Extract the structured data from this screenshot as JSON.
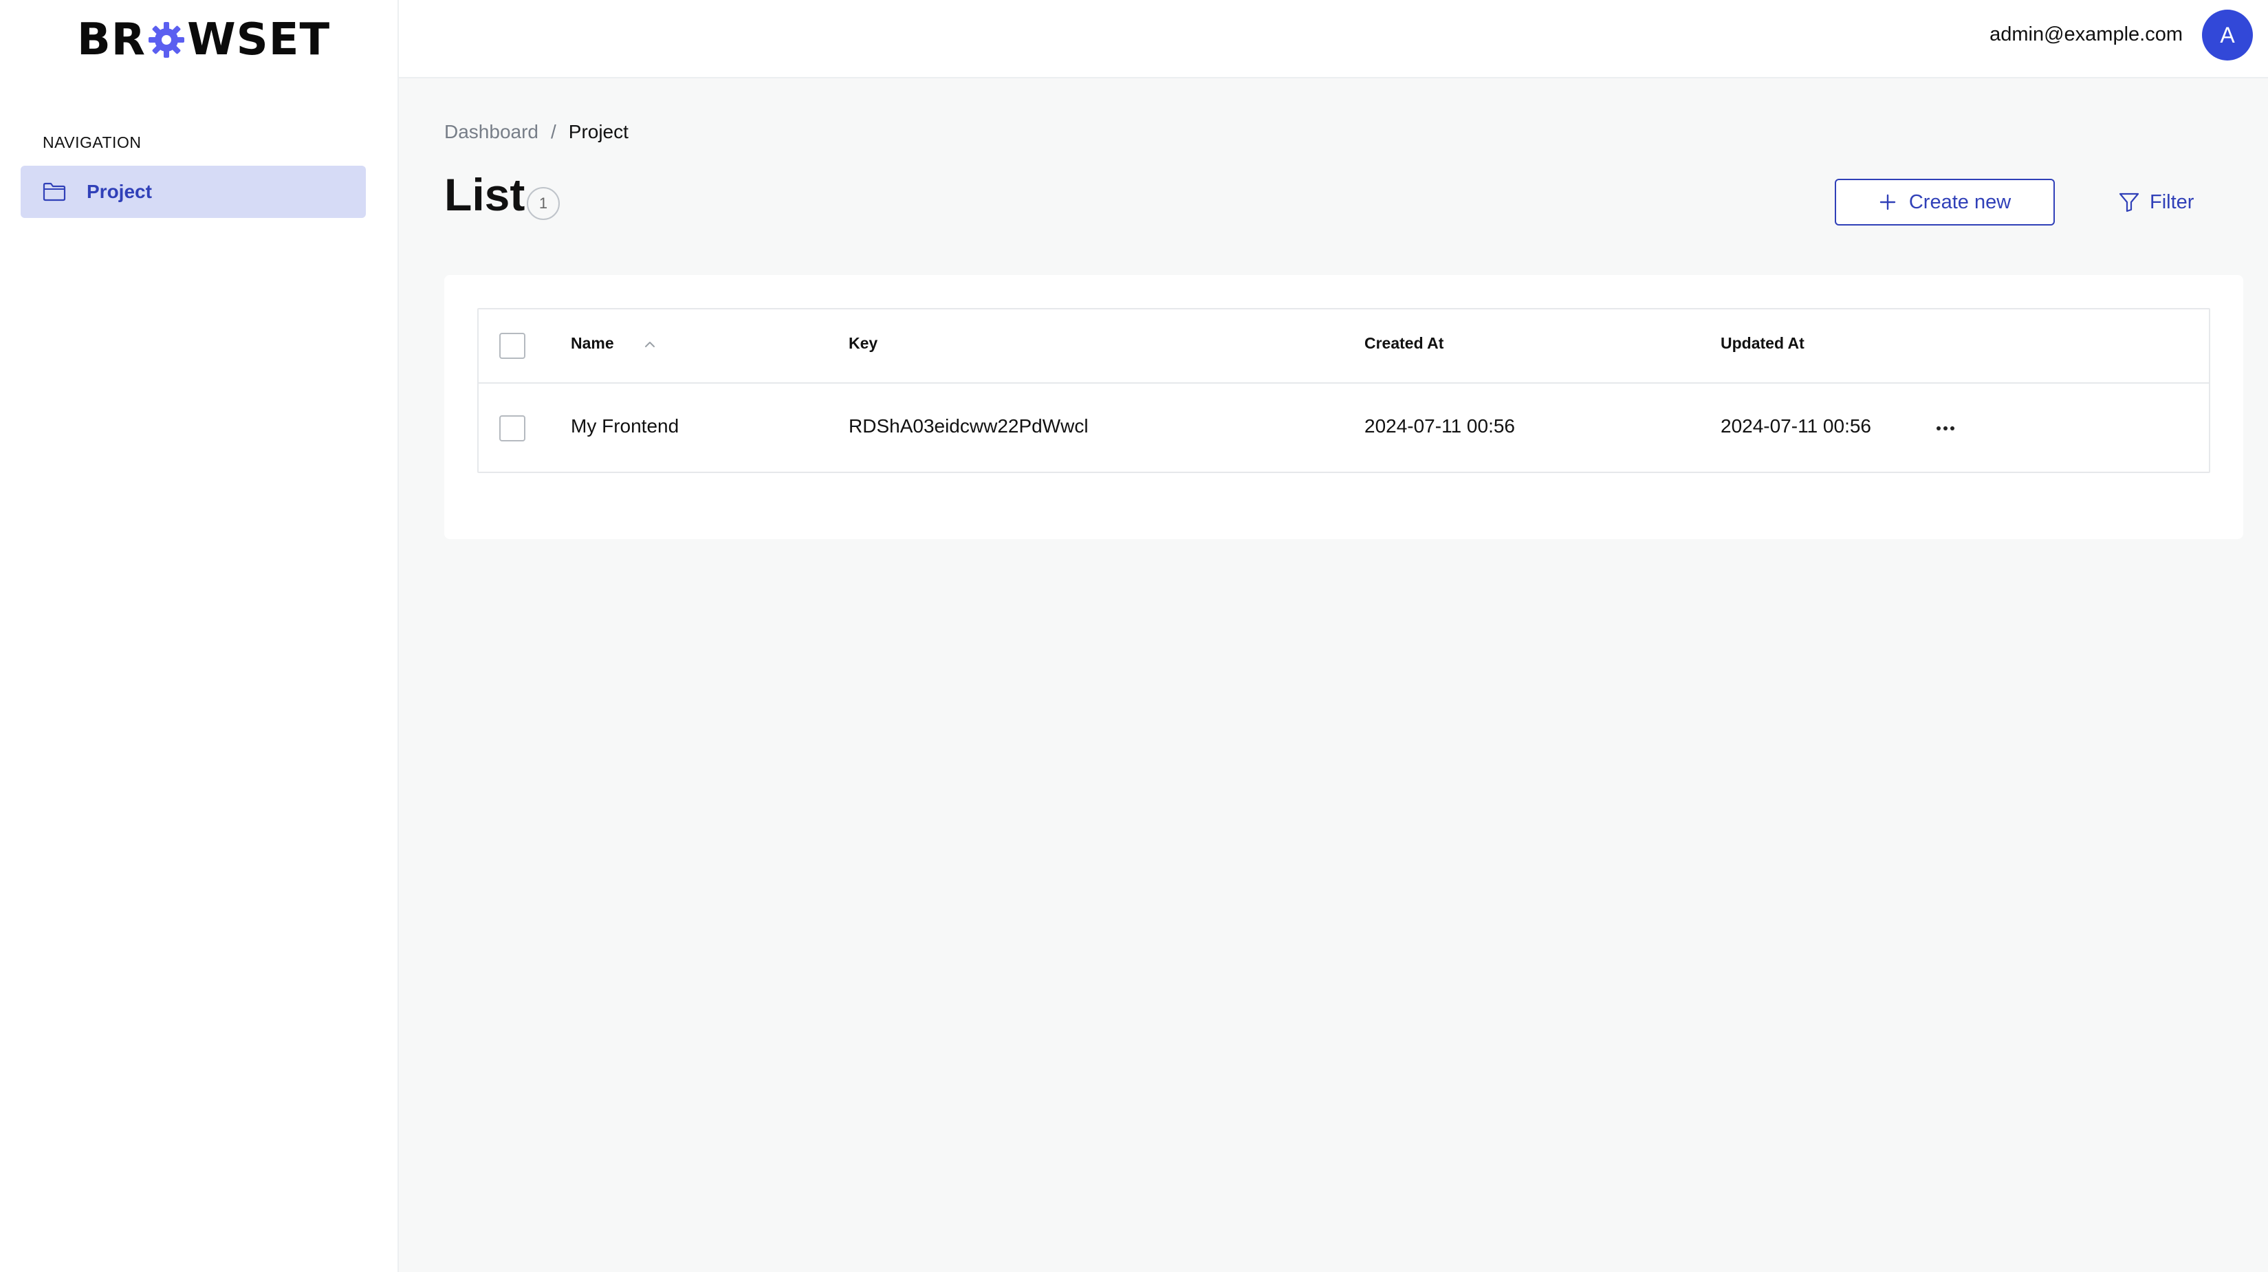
{
  "app": {
    "logo_text_left": "BR",
    "logo_text_right": "WSET",
    "brand_color": "#3040b8",
    "logo_gear_color": "#5b5ff0"
  },
  "sidebar": {
    "heading": "NAVIGATION",
    "items": [
      {
        "label": "Project",
        "icon": "folder-icon",
        "active": true
      }
    ]
  },
  "topbar": {
    "user_email": "admin@example.com",
    "avatar_initial": "A",
    "avatar_color": "#3248d8"
  },
  "breadcrumb": {
    "items": [
      "Dashboard",
      "Project"
    ],
    "separator": "/"
  },
  "page": {
    "title": "List",
    "count": "1"
  },
  "actions": {
    "create_label": "Create new",
    "filter_label": "Filter"
  },
  "table": {
    "columns": [
      "Name",
      "Key",
      "Created At",
      "Updated At"
    ],
    "sorted_by": "Name",
    "rows": [
      {
        "name": "My Frontend",
        "key": "RDShA03eidcww22PdWwcl",
        "created_at": "2024-07-11 00:56",
        "updated_at": "2024-07-11 00:56"
      }
    ]
  }
}
